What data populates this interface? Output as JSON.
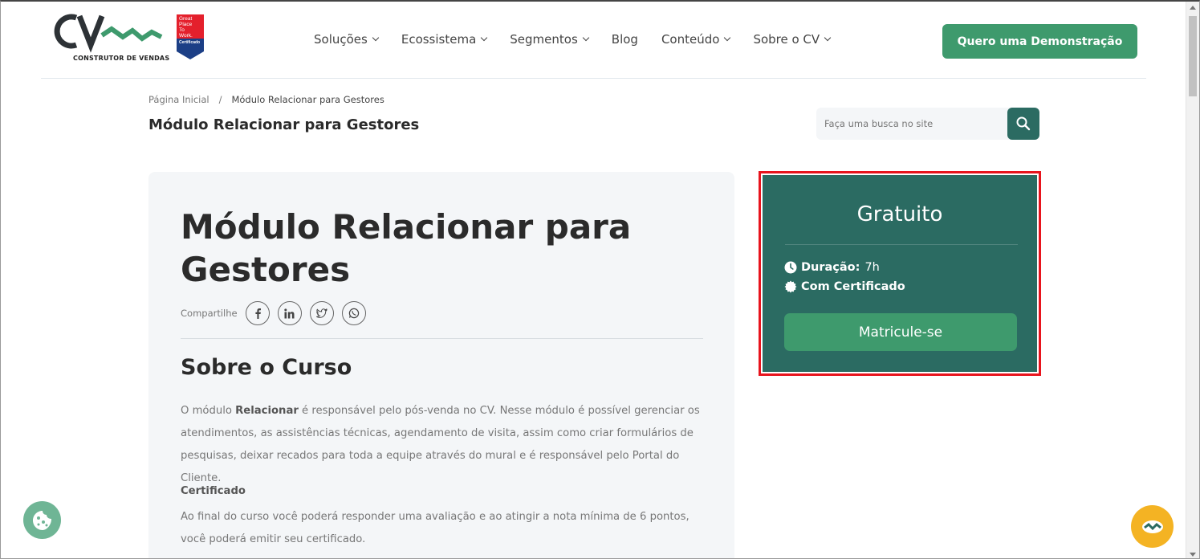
{
  "header": {
    "logo_tagline": "CONSTRUTOR DE VENDAS",
    "gptw_lines": [
      "Great",
      "Place",
      "To",
      "Work."
    ],
    "gptw_cert": "Certificado",
    "nav": [
      {
        "label": "Soluções",
        "dropdown": true
      },
      {
        "label": "Ecossistema",
        "dropdown": true
      },
      {
        "label": "Segmentos",
        "dropdown": true
      },
      {
        "label": "Blog",
        "dropdown": false
      },
      {
        "label": "Conteúdo",
        "dropdown": true
      },
      {
        "label": "Sobre o CV",
        "dropdown": true
      }
    ],
    "demo_button": "Quero uma Demonstração"
  },
  "breadcrumb": {
    "home": "Página Inicial",
    "separator": "/",
    "current": "Módulo Relacionar para Gestores"
  },
  "page_title": "Módulo Relacionar para Gestores",
  "search": {
    "placeholder": "Faça uma busca no site",
    "value": ""
  },
  "course": {
    "title": "Módulo Relacionar para Gestores",
    "share_label": "Compartilhe",
    "share_icons": [
      "facebook-icon",
      "linkedin-icon",
      "twitter-icon",
      "whatsapp-icon"
    ],
    "section_title": "Sobre o Curso",
    "description_pre": "O módulo ",
    "description_bold": "Relacionar",
    "description_post": " é responsável pelo pós-venda no CV. Nesse módulo é possível gerenciar os atendimentos, as assistências técnicas, agendamento de visita, assim como criar formulários de pesquisas, deixar recados para toda a equipe através do mural e é responsável pelo Portal do Cliente.",
    "certificate_title": "Certificado",
    "certificate_text": "Ao final do curso você poderá responder uma avaliação e ao atingir a nota mínima de 6 pontos, você poderá emitir seu certificado."
  },
  "sidebar": {
    "price": "Gratuito",
    "duration_label": "Duração:",
    "duration_value": "7h",
    "certificate_label": "Com Certificado",
    "enroll_button": "Matricule-se"
  },
  "colors": {
    "primary_green": "#3e9a6d",
    "dark_teal": "#2b6b62",
    "highlight_red": "#e8141d",
    "chat_yellow": "#f4b323"
  }
}
